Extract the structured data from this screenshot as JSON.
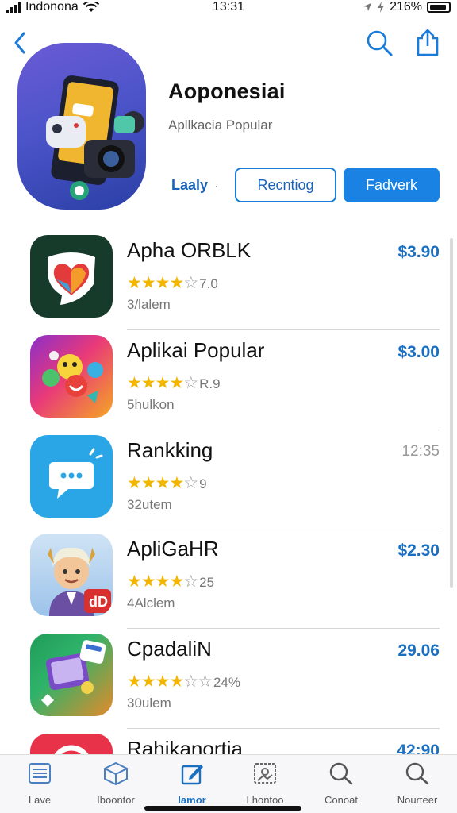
{
  "status_bar": {
    "carrier": "Indonona",
    "time": "13:31",
    "battery": "216%"
  },
  "header": {
    "icons": [
      "back-chevron-icon",
      "search-icon",
      "share-icon"
    ],
    "title": "Aoponesiai",
    "subtitle": "Apllkacia Popular",
    "segment_label": "Laaly",
    "segment_separator": "·",
    "outline_button": "Recntiog",
    "primary_button": "Fadverk"
  },
  "apps": [
    {
      "name": "Apha ORBLK",
      "stars": 4,
      "rating": "7.0",
      "sub": "3/lalem",
      "price": "$3.90",
      "price_style": "accent",
      "icon": "heart-shield-icon"
    },
    {
      "name": "Aplikai Popular",
      "stars": 4,
      "rating": "R.9",
      "sub": "5hulkon",
      "price": "$3.00",
      "price_style": "accent",
      "icon": "emoji-burst-icon"
    },
    {
      "name": "Rankking",
      "stars": 4,
      "rating": "9",
      "sub": "32utem",
      "price": "12:35",
      "price_style": "gray",
      "icon": "chat-bubble-icon"
    },
    {
      "name": "ApliGaHR",
      "stars": 4,
      "rating": "25",
      "sub": "4Alclem",
      "price": "$2.30",
      "price_style": "accent",
      "icon": "avatar-character-icon"
    },
    {
      "name": "CpadaliN",
      "stars": 4,
      "rating": "24%",
      "sub": "30ulem",
      "price": "29.06",
      "price_style": "accent",
      "icon": "game-tablet-icon"
    },
    {
      "name": "Rahikanortia",
      "stars": 0,
      "rating": "",
      "sub": "",
      "price": "42:90",
      "price_style": "accent",
      "icon": "red-circle-app-icon"
    }
  ],
  "tabs": [
    {
      "label": "Lave",
      "icon": "list-icon",
      "active": false
    },
    {
      "label": "Iboontor",
      "icon": "cube-icon",
      "active": false
    },
    {
      "label": "Iamor",
      "icon": "edit-icon",
      "active": true
    },
    {
      "label": "Lhontoo",
      "icon": "image-frame-icon",
      "active": false
    },
    {
      "label": "Conoat",
      "icon": "search-icon",
      "active": false
    },
    {
      "label": "Nourteer",
      "icon": "search-icon",
      "active": false
    }
  ],
  "colors": {
    "accent": "#1a82e2",
    "price": "#1a6fc0",
    "star": "#f2b600"
  }
}
